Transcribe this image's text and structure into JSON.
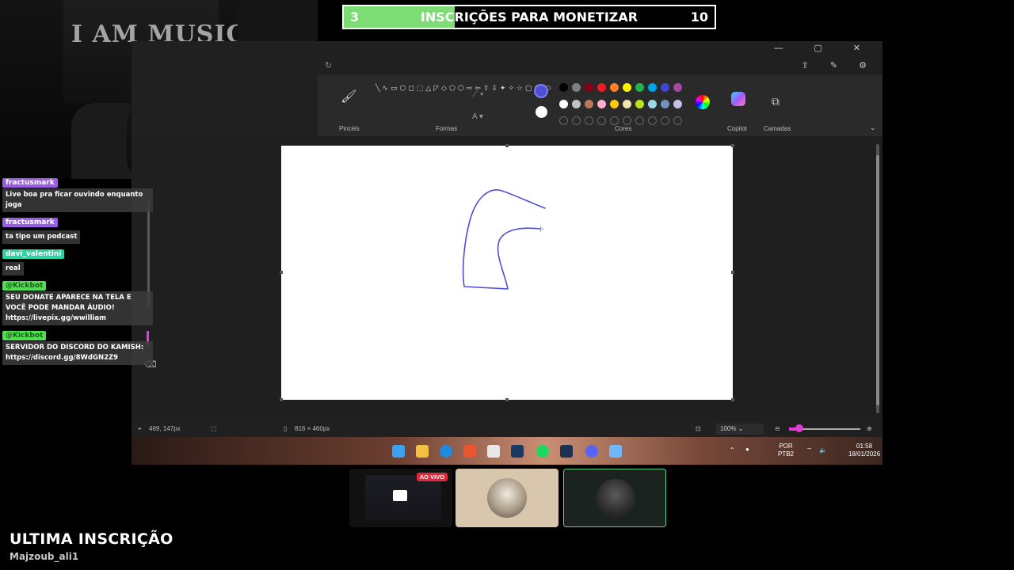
{
  "goal": {
    "start": "3",
    "title": "INSCRIÇÕES PARA MONETIZAR",
    "end": "10",
    "progress_fraction": 0.3,
    "fill_color": "#7ddd74"
  },
  "webcam": {
    "banner_text": "I AM MUSIC"
  },
  "chat": {
    "messages": [
      {
        "user": "fractusmark",
        "text": "Live boa pra ficar ouvindo enquanto joga"
      },
      {
        "user": "fractusmark",
        "text": "ta tipo um podcast"
      },
      {
        "user": "davi_valentini",
        "text": "real"
      },
      {
        "user": "@Kickbot",
        "text": "SEU DONATE APARECE NA TELA E VOCÊ PODE MANDAR ÁUDIO! https://livepix.gg/wwilliam"
      },
      {
        "user": "@Kickbot",
        "text": "SERVIDOR DO DISCORD DO KAMISH: https://discord.gg/8WdGN2Z9"
      }
    ]
  },
  "paint": {
    "groups": {
      "brushes": "Pincéis",
      "shapes": "Formas",
      "colors": "Cores",
      "copilot": "Copilot",
      "layers": "Camadas"
    },
    "shape_glyphs": "╲∿▭⬡◻⬚△◸◇⬠⬡⇨⇦⇧⇩✦✧☆▢◯⬭",
    "primary_color": "#4d4fd4",
    "secondary_color": "#ffffff",
    "palette": [
      "#000000",
      "#7f7f7f",
      "#880015",
      "#ed1c24",
      "#ff7f27",
      "#fff200",
      "#22b14c",
      "#00a2e8",
      "#3f48cc",
      "#a349a4",
      "#ffffff",
      "#c3c3c3",
      "#b97a57",
      "#ffaec9",
      "#ffc90e",
      "#efe4b0",
      "#b5e61d",
      "#99d9ea",
      "#7092be",
      "#c8bfe7"
    ],
    "status": {
      "cursor_pos": "469, 147px",
      "canvas_size": "816 × 460px",
      "zoom": "100%"
    },
    "tray": {
      "lang": "POR",
      "layout": "PTB2",
      "time": "01:58",
      "date": "18/01/2026"
    }
  },
  "call": {
    "live_badge": "AO VIVO"
  },
  "last_sub": {
    "title": "ULTIMA INSCRIÇÃO",
    "name": "Majzoub_ali1"
  }
}
